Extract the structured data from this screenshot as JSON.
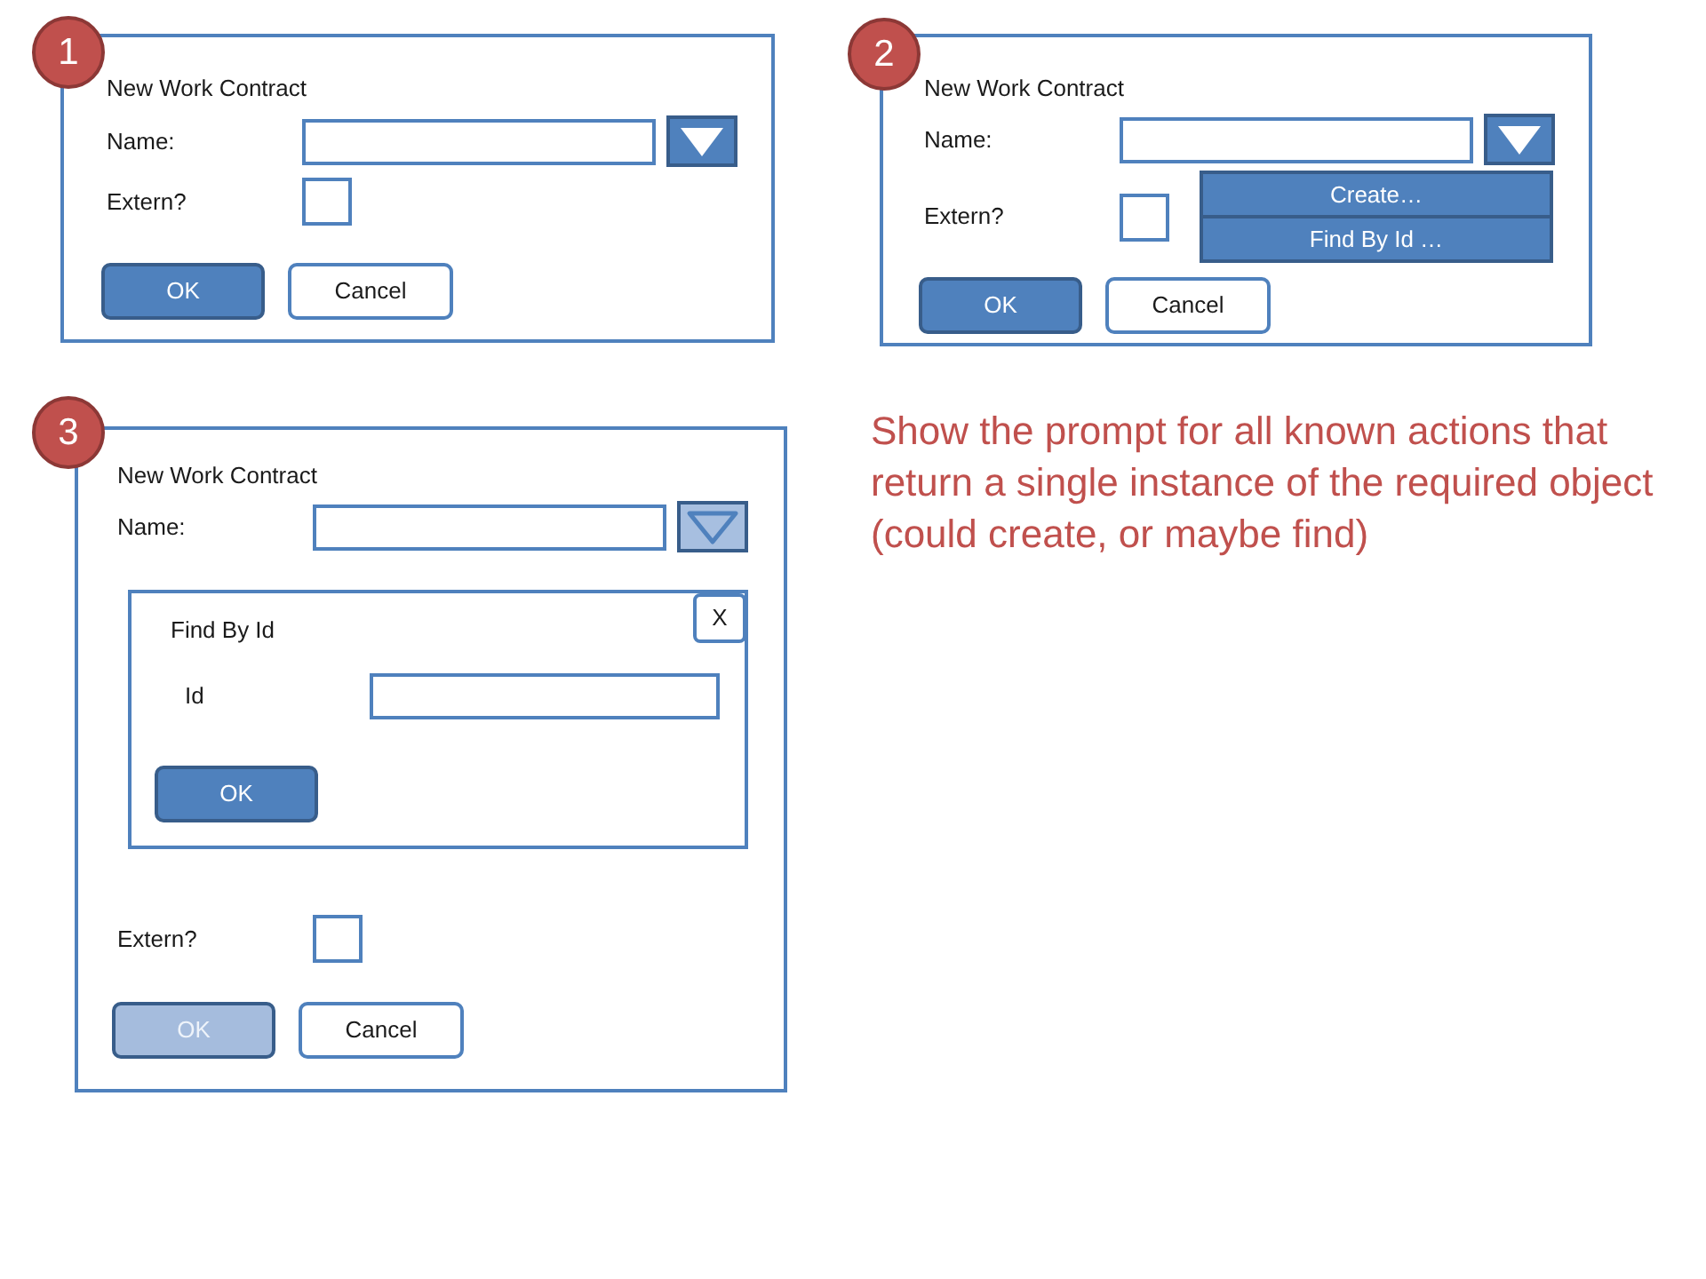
{
  "panels": [
    {
      "badge": "1",
      "title": "New Work Contract",
      "name_label": "Name:",
      "dropdown": {
        "pressed": false
      },
      "extern_label": "Extern?",
      "extern_checked": false,
      "buttons": [
        {
          "label": "OK",
          "kind": "primary",
          "disabled": false
        },
        {
          "label": "Cancel",
          "kind": "secondary",
          "disabled": false
        }
      ]
    },
    {
      "badge": "2",
      "title": "New Work Contract",
      "name_label": "Name:",
      "dropdown": {
        "pressed": false,
        "menu": [
          "Create…",
          "Find By Id …"
        ]
      },
      "extern_label": "Extern?",
      "extern_checked": false,
      "buttons": [
        {
          "label": "OK",
          "kind": "primary",
          "disabled": false
        },
        {
          "label": "Cancel",
          "kind": "secondary",
          "disabled": false
        }
      ]
    },
    {
      "badge": "3",
      "title": "New Work Contract",
      "name_label": "Name:",
      "dropdown": {
        "pressed": true
      },
      "subdialog": {
        "title": "Find By Id",
        "close": "X",
        "field_label": "Id",
        "button": "OK"
      },
      "extern_label": "Extern?",
      "extern_checked": false,
      "buttons": [
        {
          "label": "OK",
          "kind": "primary",
          "disabled": true
        },
        {
          "label": "Cancel",
          "kind": "secondary",
          "disabled": false
        }
      ]
    }
  ],
  "note": "Show the prompt for all known actions that\nreturn a single instance of the required object\n(could create, or maybe find)"
}
